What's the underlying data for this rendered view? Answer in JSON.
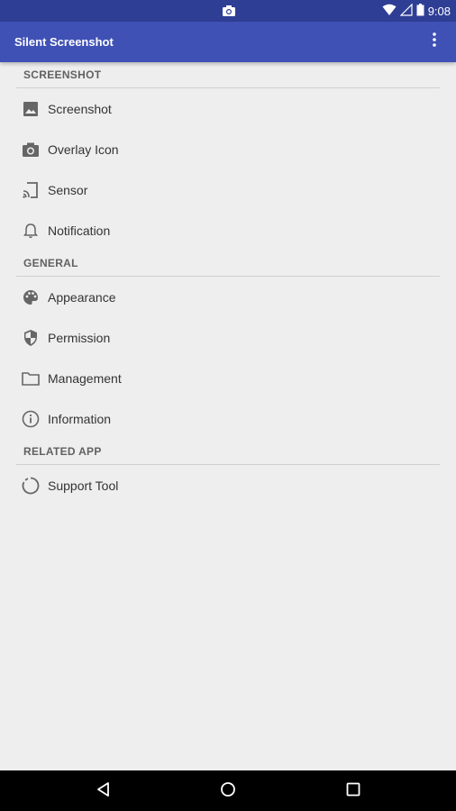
{
  "status_bar": {
    "time": "9:08",
    "icons": [
      "camera-icon",
      "wifi-icon",
      "signal-icon",
      "battery-icon"
    ]
  },
  "app_bar": {
    "title": "Silent Screenshot",
    "menu_icon": "overflow-menu-icon"
  },
  "sections": [
    {
      "header": "SCREENSHOT",
      "items": [
        {
          "label": "Screenshot",
          "icon": "image-icon"
        },
        {
          "label": "Overlay Icon",
          "icon": "camera-icon"
        },
        {
          "label": "Sensor",
          "icon": "cast-icon"
        },
        {
          "label": "Notification",
          "icon": "bell-icon"
        }
      ]
    },
    {
      "header": "GENERAL",
      "items": [
        {
          "label": "Appearance",
          "icon": "palette-icon"
        },
        {
          "label": "Permission",
          "icon": "shield-icon"
        },
        {
          "label": "Management",
          "icon": "folder-icon"
        },
        {
          "label": "Information",
          "icon": "info-icon"
        }
      ]
    },
    {
      "header": "RELATED APP",
      "items": [
        {
          "label": "Support Tool",
          "icon": "loading-circle-icon"
        }
      ]
    }
  ],
  "nav_bar": {
    "icons": [
      "back-icon",
      "home-icon",
      "recents-icon"
    ]
  },
  "colors": {
    "primary": "#3f51b5",
    "primary_dark": "#2f3e95",
    "background": "#eeeeee"
  }
}
